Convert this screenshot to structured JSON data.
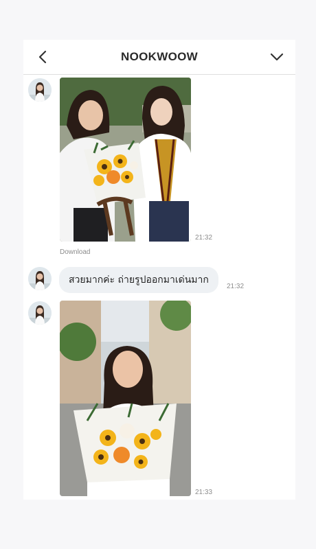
{
  "header": {
    "title": "NOOKWOOW",
    "back_icon": "chevron-left-icon",
    "menu_icon": "chevron-down-icon"
  },
  "messages": [
    {
      "type": "image",
      "time": "21:32",
      "download_label": "Download"
    },
    {
      "type": "text",
      "text": "สวยมากค่ะ ถ่ายรูปออกมาเด่นมาก",
      "time": "21:32"
    },
    {
      "type": "image",
      "time": "21:33"
    }
  ],
  "colors": {
    "background": "#f7f7f9",
    "panel": "#ffffff",
    "bubble": "#eef1f4",
    "meta_text": "#8c8c8c"
  }
}
